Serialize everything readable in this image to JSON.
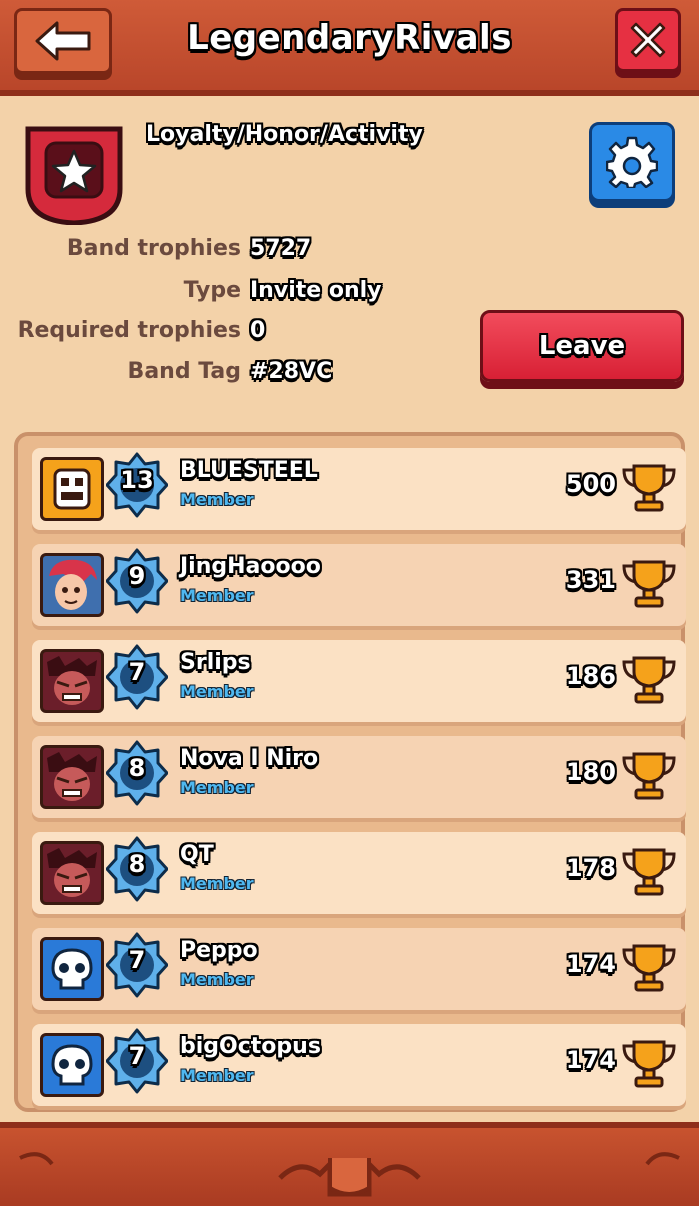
{
  "header": {
    "title": "LegendaryRivals",
    "back_icon": "back-arrow-icon",
    "close_icon": "close-x-icon"
  },
  "band": {
    "motto": "Loyalty/Honor/Activity",
    "badge_icon": "star-badge-icon",
    "settings_icon": "gear-icon",
    "info": [
      {
        "label": "Band trophies",
        "value": "5727"
      },
      {
        "label": "Type",
        "value": "Invite only"
      },
      {
        "label": "Required trophies",
        "value": "0"
      },
      {
        "label": "Band Tag",
        "value": "#28VC"
      }
    ],
    "leave_label": "Leave"
  },
  "members": [
    {
      "level": "13",
      "name": "BLUESTEEL",
      "role": "Member",
      "trophies": "500",
      "avatar": "robot-avatar"
    },
    {
      "level": "9",
      "name": "JingHaoooo",
      "role": "Member",
      "trophies": "331",
      "avatar": "girl-avatar"
    },
    {
      "level": "7",
      "name": "Srlips",
      "role": "Member",
      "trophies": "186",
      "avatar": "angry-avatar"
    },
    {
      "level": "8",
      "name": "Nova I Niro",
      "role": "Member",
      "trophies": "180",
      "avatar": "angry-avatar"
    },
    {
      "level": "8",
      "name": "QT",
      "role": "Member",
      "trophies": "178",
      "avatar": "angry-avatar"
    },
    {
      "level": "7",
      "name": "Peppo",
      "role": "Member",
      "trophies": "174",
      "avatar": "skull-avatar"
    },
    {
      "level": "7",
      "name": "bigOctopus",
      "role": "Member",
      "trophies": "174",
      "avatar": "skull-avatar"
    }
  ],
  "colors": {
    "background": "#f3d2a9",
    "header": "#c8532f",
    "leave_button": "#e63042",
    "settings_button": "#2a8ae6",
    "role_text": "#4fb8f0"
  }
}
